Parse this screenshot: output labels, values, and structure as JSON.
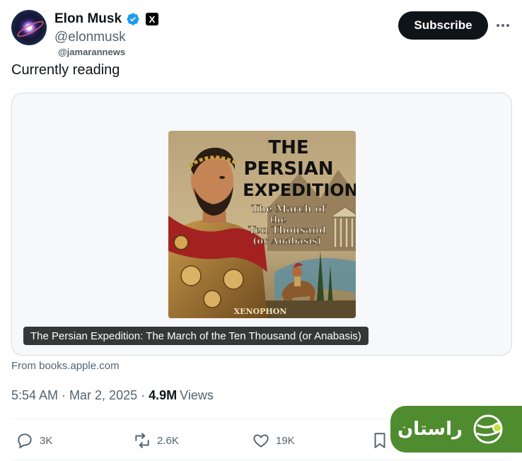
{
  "author": {
    "name": "Elon Musk",
    "handle": "@elonmusk",
    "affiliation_badge": "X",
    "verified_icon": "verified-badge-icon"
  },
  "watermark": "@jamarannews",
  "subscribe_label": "Subscribe",
  "more_icon": "more-icon",
  "tweet": {
    "text": "Currently reading"
  },
  "card": {
    "cover_title_line1": "THE",
    "cover_title_line2": "PERSIAN",
    "cover_title_line3": "EXPEDITION",
    "cover_subtitle_line1": "The March of",
    "cover_subtitle_line2": "the",
    "cover_subtitle_line3": "Ten Thousand",
    "cover_subtitle_line4": "(or Anabasis)",
    "cover_author": "XENOPHON",
    "caption": "The Persian Expedition: The March of the Ten Thousand (or Anabasis)",
    "source": "From books.apple.com"
  },
  "meta": {
    "time": "5:54 AM",
    "separator": "·",
    "date": "Mar 2, 2025",
    "views_count": "4.9M",
    "views_label": "Views"
  },
  "actions": {
    "replies": "3K",
    "reposts": "2.6K",
    "likes": "19K"
  },
  "brand_overlay": {
    "text": "راستان"
  },
  "colors": {
    "text_primary": "#0f1419",
    "text_secondary": "#536471",
    "verified_blue": "#1d9bf0",
    "brand_green": "#4f8b2f"
  }
}
